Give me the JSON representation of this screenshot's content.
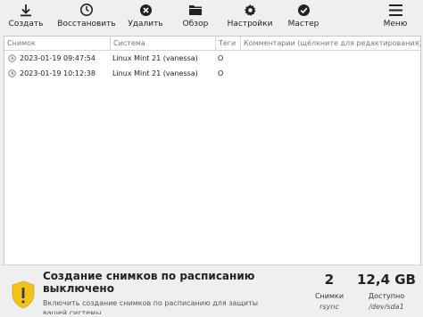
{
  "toolbar": {
    "create": "Создать",
    "restore": "Восстановить",
    "delete": "Удалить",
    "browse": "Обзор",
    "settings": "Настройки",
    "wizard": "Мастер",
    "menu": "Меню"
  },
  "table": {
    "columns": [
      "Снимок",
      "Система",
      "Теги",
      "Комментарии (щёлкните для редактирования)"
    ],
    "rows": [
      {
        "snapshot": "2023-01-19 09:47:54",
        "system": "Linux Mint 21 (vanessa)",
        "tags": "O",
        "comment": ""
      },
      {
        "snapshot": "2023-01-19 10:12:38",
        "system": "Linux Mint 21 (vanessa)",
        "tags": "O",
        "comment": ""
      }
    ]
  },
  "status": {
    "title": "Создание снимков по расписанию выключено",
    "subtitle": "Включить создание снимков по расписанию для защиты вашей системы",
    "snapshots_count": "2",
    "snapshots_label": "Снимки",
    "snapshots_mode": "rsync",
    "free_space": "12,4 GB",
    "free_label": "Доступно",
    "device": "/dev/sda1"
  },
  "colors": {
    "warning_shield": "#f0c419",
    "accent_text": "#222222"
  }
}
